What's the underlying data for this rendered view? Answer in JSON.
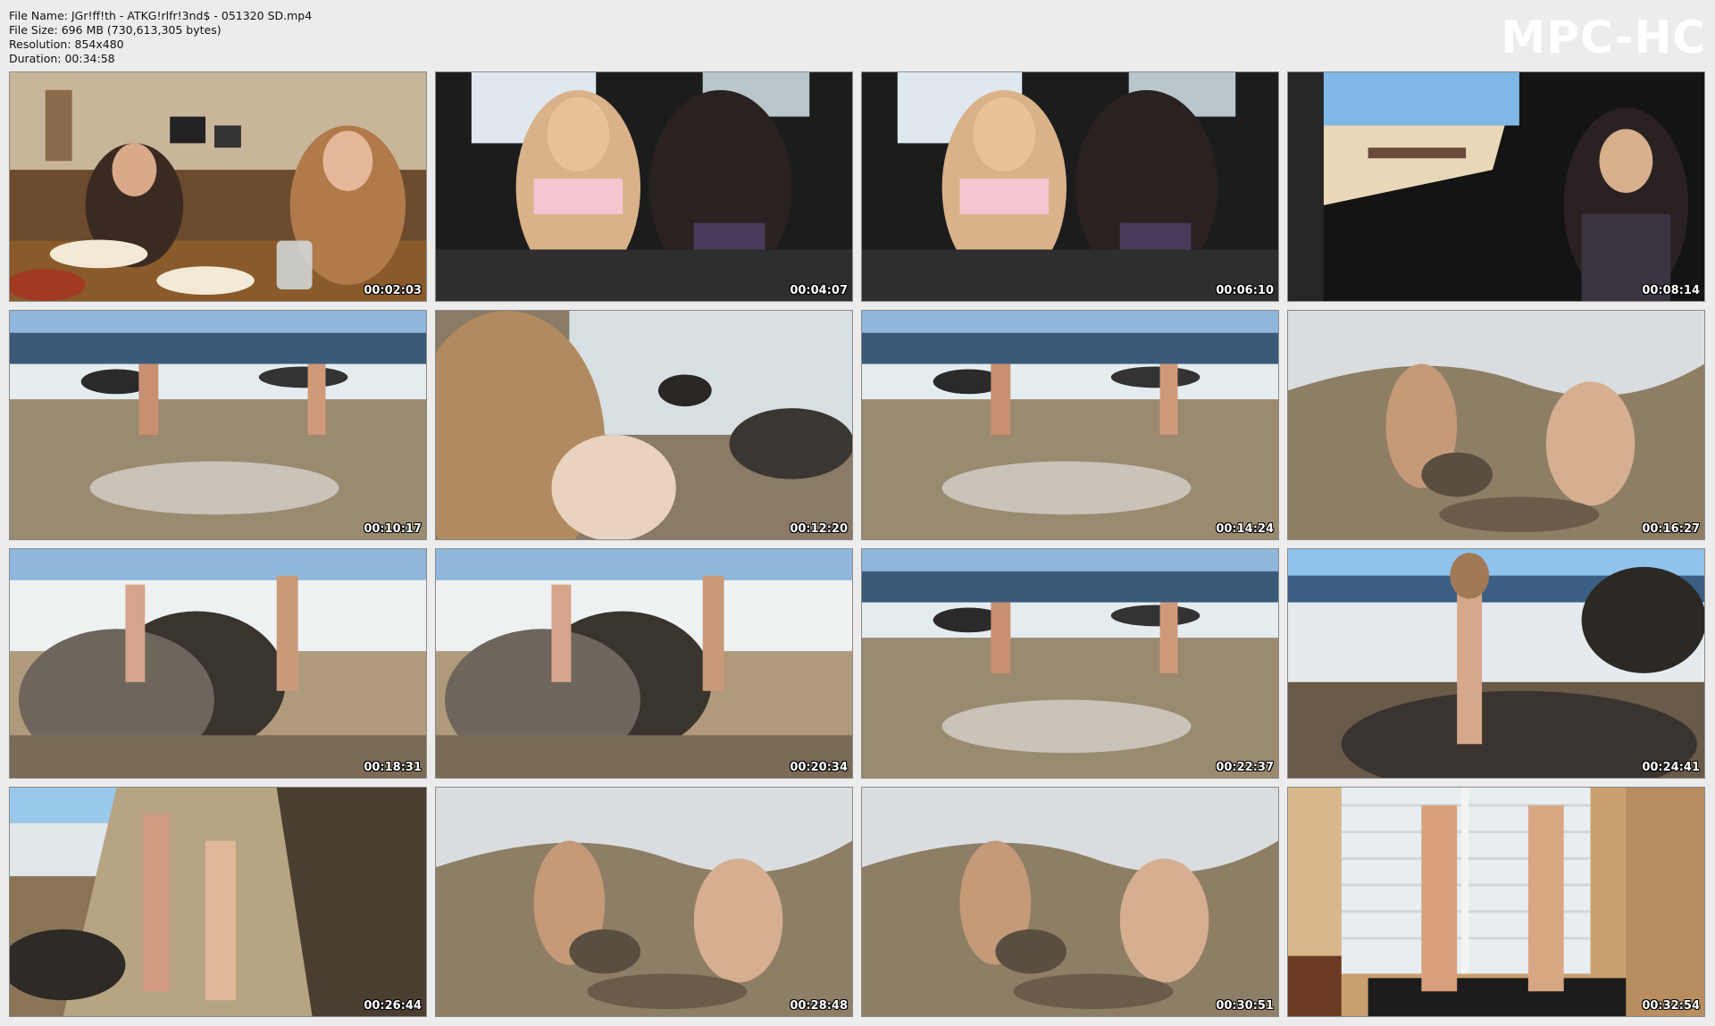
{
  "info": {
    "file_name_line": "File Name: JGr!ff!th - ATKG!rlfr!3nd$ - 051320 SD.mp4",
    "file_size_line": "File Size: 696 MB (730,613,305 bytes)",
    "resolution_line": "Resolution: 854x480",
    "duration_line": "Duration: 00:34:58"
  },
  "logo": "MPC-HC",
  "thumbnails": [
    {
      "time": "00:02:03",
      "scene": "restaurant"
    },
    {
      "time": "00:04:07",
      "scene": "car-interior"
    },
    {
      "time": "00:06:10",
      "scene": "car-interior"
    },
    {
      "time": "00:08:14",
      "scene": "car-window"
    },
    {
      "time": "00:10:17",
      "scene": "beach-walk"
    },
    {
      "time": "00:12:20",
      "scene": "beach-closeup"
    },
    {
      "time": "00:14:24",
      "scene": "beach-walk"
    },
    {
      "time": "00:16:27",
      "scene": "beach-sand"
    },
    {
      "time": "00:18:31",
      "scene": "beach-rock"
    },
    {
      "time": "00:20:34",
      "scene": "beach-rock"
    },
    {
      "time": "00:22:37",
      "scene": "beach-walk"
    },
    {
      "time": "00:24:41",
      "scene": "beach-rocks"
    },
    {
      "time": "00:26:44",
      "scene": "cliff"
    },
    {
      "time": "00:28:48",
      "scene": "beach-sand"
    },
    {
      "time": "00:30:51",
      "scene": "beach-sand"
    },
    {
      "time": "00:32:54",
      "scene": "indoor-window"
    }
  ]
}
